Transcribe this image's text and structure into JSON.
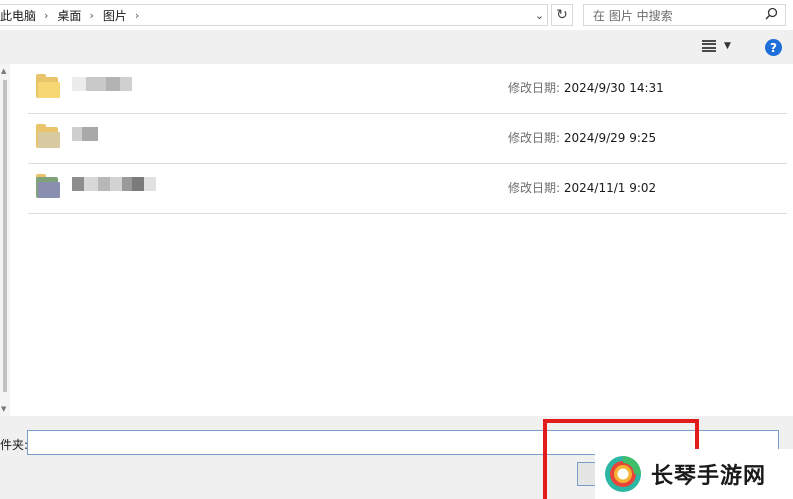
{
  "breadcrumb": {
    "items": [
      "此电脑",
      "桌面",
      "图片"
    ],
    "separator": "›",
    "trailing_separator": "›"
  },
  "address_dropdown_icon": "chevron-down-icon",
  "refresh_icon": "refresh-icon",
  "search": {
    "placeholder": "在 图片 中搜索",
    "icon": "search-icon"
  },
  "toolbar": {
    "view_icon": "view-list-icon",
    "view_dropdown_icon": "caret-down-icon",
    "help_label": "?",
    "help_color": "#1e6fd9"
  },
  "files": [
    {
      "name_blurred": true,
      "date_label": "修改日期:",
      "date_value": "2024/9/30 14:31"
    },
    {
      "name_blurred": true,
      "date_label": "修改日期:",
      "date_value": "2024/9/29 9:25"
    },
    {
      "name_blurred": true,
      "date_label": "修改日期:",
      "date_value": "2024/11/1 9:02"
    }
  ],
  "footer": {
    "folder_label": "件夹:",
    "folder_value": ""
  },
  "overlay": {
    "highlight_color": "#e21b1b",
    "watermark_text": "长琴手游网"
  }
}
